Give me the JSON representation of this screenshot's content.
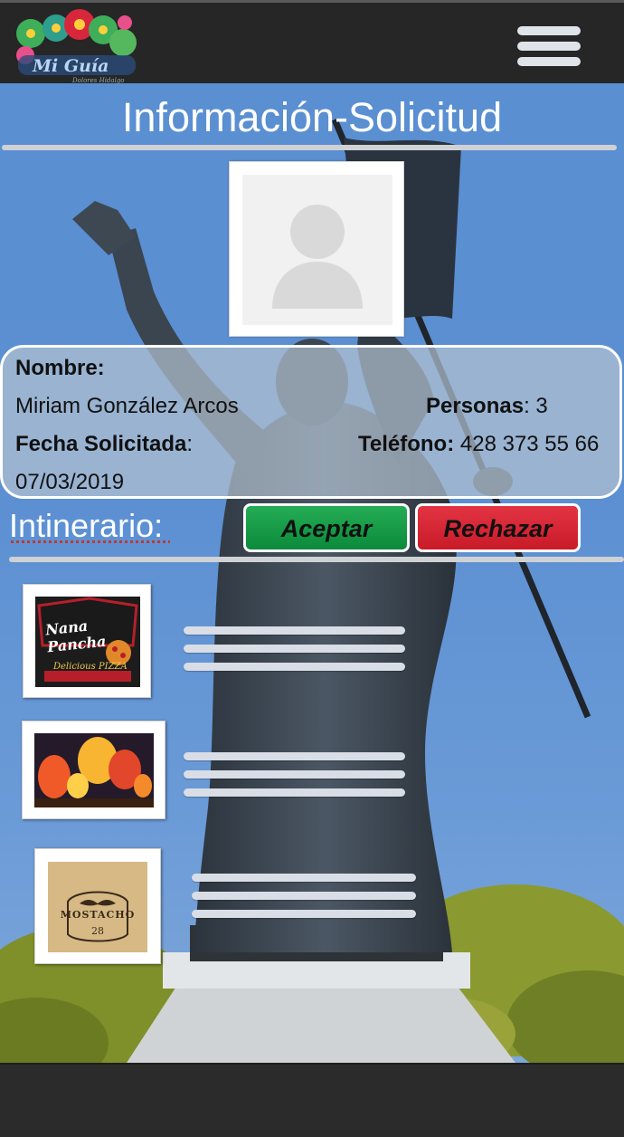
{
  "header": {
    "logo_alt": "Mi Guía",
    "menu_label": "menu"
  },
  "page": {
    "title": "Información-Solicitud"
  },
  "request": {
    "name_label": "Nombre:",
    "name_value": "Miriam González Arcos",
    "people_label": "Personas",
    "people_value": ": 3",
    "date_label": "Fecha Solicitada",
    "date_colon": ":",
    "date_value": "07/03/2019",
    "phone_label": "Teléfono:",
    "phone_value": " 428 373 55 66"
  },
  "itinerary": {
    "label": "Intinerario",
    "colon": ":",
    "accept_label": "Aceptar",
    "reject_label": "Rechazar",
    "items": [
      {
        "title": "Nana Pancha",
        "subtitle": "Delicious PIZZA",
        "icon": "pizza-logo"
      },
      {
        "title": "",
        "subtitle": "",
        "icon": "hot-air-balloons-photo"
      },
      {
        "title": "MOSTACHO",
        "subtitle": "28",
        "icon": "mostacho-logo"
      }
    ]
  },
  "colors": {
    "accent_green": "#0e9444",
    "accent_red": "#d21f2e",
    "header_bg": "#262626",
    "sky": "#5b8fd2"
  }
}
